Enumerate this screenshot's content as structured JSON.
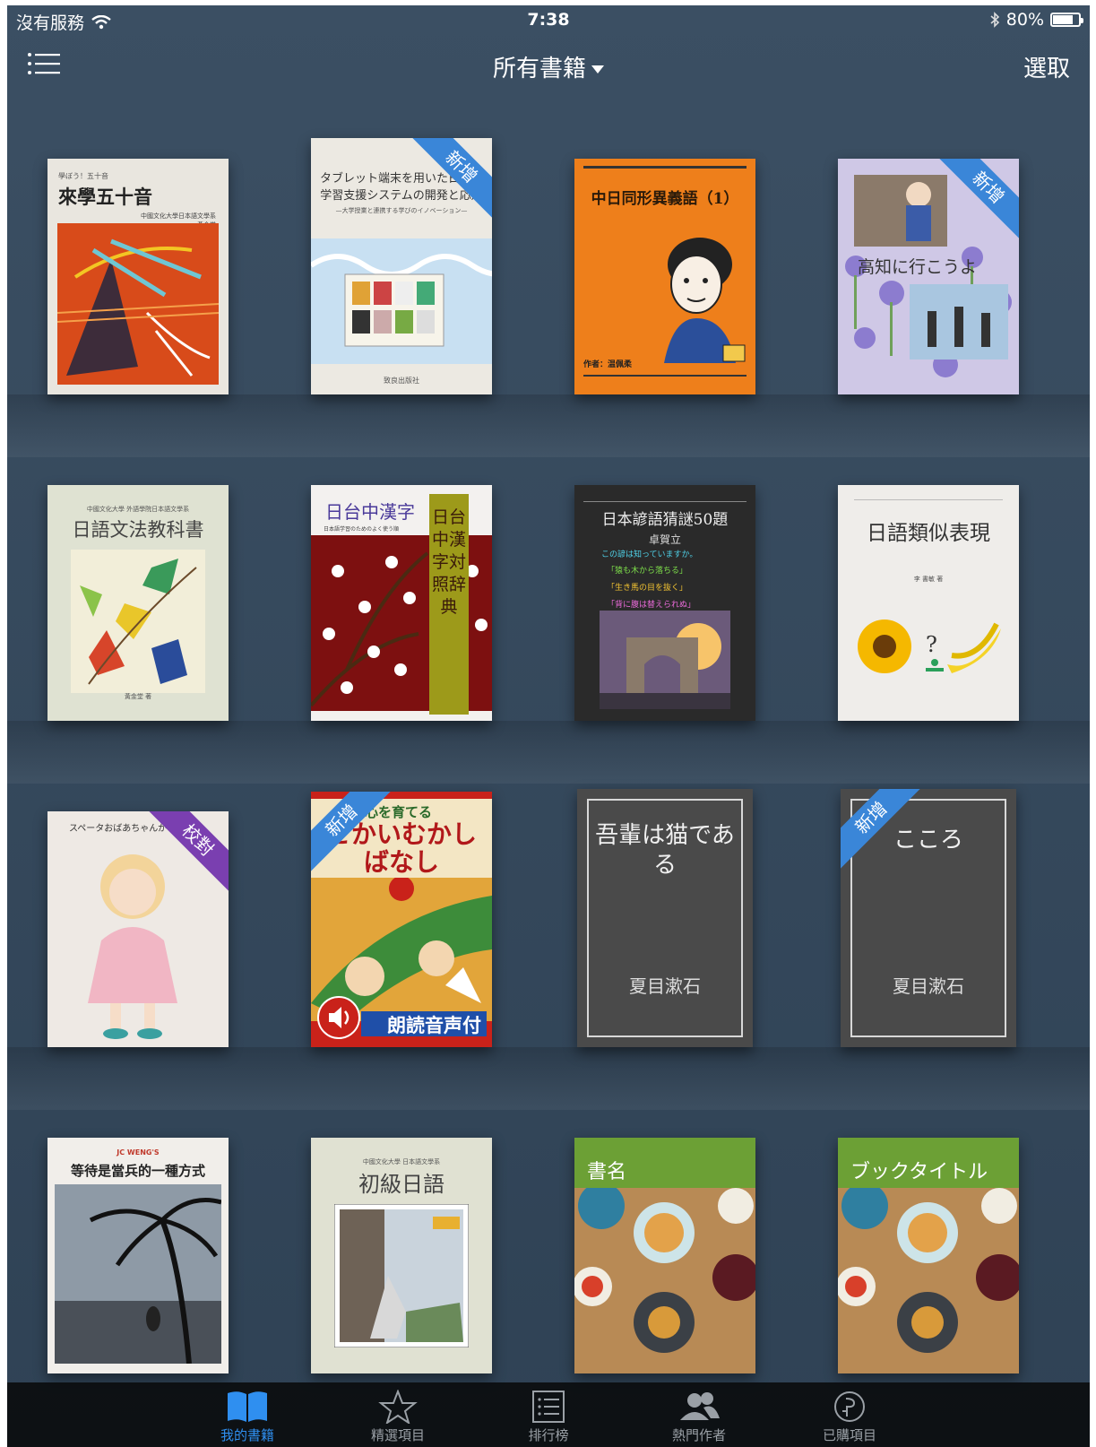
{
  "status": {
    "carrier": "沒有服務",
    "time": "7:38",
    "battery": "80%",
    "battery_level": 0.8
  },
  "nav": {
    "title": "所有書籍",
    "select_label": "選取"
  },
  "ribbons": {
    "new": "新增",
    "proofread": "校對"
  },
  "books": [
    {
      "title": "來學五十音",
      "subtitle": "學ぼう！五十音",
      "author": "黃金堂",
      "publisher": "中國文化大學日本語文學系"
    },
    {
      "title": "タブレット端末を用いた日本語学習支援システムの開発と応用",
      "subtitle": "—大学授業と連携する学びのイノベーション—",
      "publisher": "致良出版社",
      "ribbon": "新增"
    },
    {
      "title": "中日同形異義語（1）",
      "author": "作者：温佩柔"
    },
    {
      "title": "高知に行こうよ",
      "ribbon": "新增"
    },
    {
      "title": "日語文法教科書",
      "publisher": "中國文化大學 外語學院日本語文學系",
      "author": "黃金堂 著"
    },
    {
      "title": "日台中漢字",
      "subtitle": "日本語学習のためのよく使う順",
      "side": "日台中漢字対照辞典"
    },
    {
      "title": "日本諺語猜謎50題",
      "author": "卓賀立",
      "lines": [
        "この諺は知っていますか。",
        "「猿も木から落ちる」",
        "「生き馬の目を抜く」",
        "「背に腹は替えられぬ」"
      ]
    },
    {
      "title": "日語類似表現",
      "author": "李 書敏 著"
    },
    {
      "title": "スペータおばあちゃんが",
      "ribbon": "校對"
    },
    {
      "title": "せかいむかしばなし",
      "subtitle": "心を育てる",
      "badge": "朗読音声付",
      "ribbon": "新增"
    },
    {
      "title": "吾輩は猫である",
      "author": "夏目漱石"
    },
    {
      "title": "こころ",
      "author": "夏目漱石",
      "ribbon": "新增"
    },
    {
      "title": "等待是當兵的一種方式",
      "publisher": "JC WENG'S"
    },
    {
      "title": "初級日語",
      "publisher": "中國文化大學 日本語文學系"
    },
    {
      "title": "書名"
    },
    {
      "title": "ブックタイトル"
    }
  ],
  "tabs": [
    {
      "label": "我的書籍",
      "icon": "open-book-icon",
      "active": true
    },
    {
      "label": "精選項目",
      "icon": "star-icon"
    },
    {
      "label": "排行榜",
      "icon": "ranking-list-icon"
    },
    {
      "label": "熱門作者",
      "icon": "authors-icon"
    },
    {
      "label": "已購項目",
      "icon": "purchased-icon"
    }
  ],
  "colors": {
    "accent": "#2f8ff0",
    "new_ribbon": "#3a86d8",
    "proof_ribbon": "#7a3fb0",
    "background": "#35485b"
  }
}
